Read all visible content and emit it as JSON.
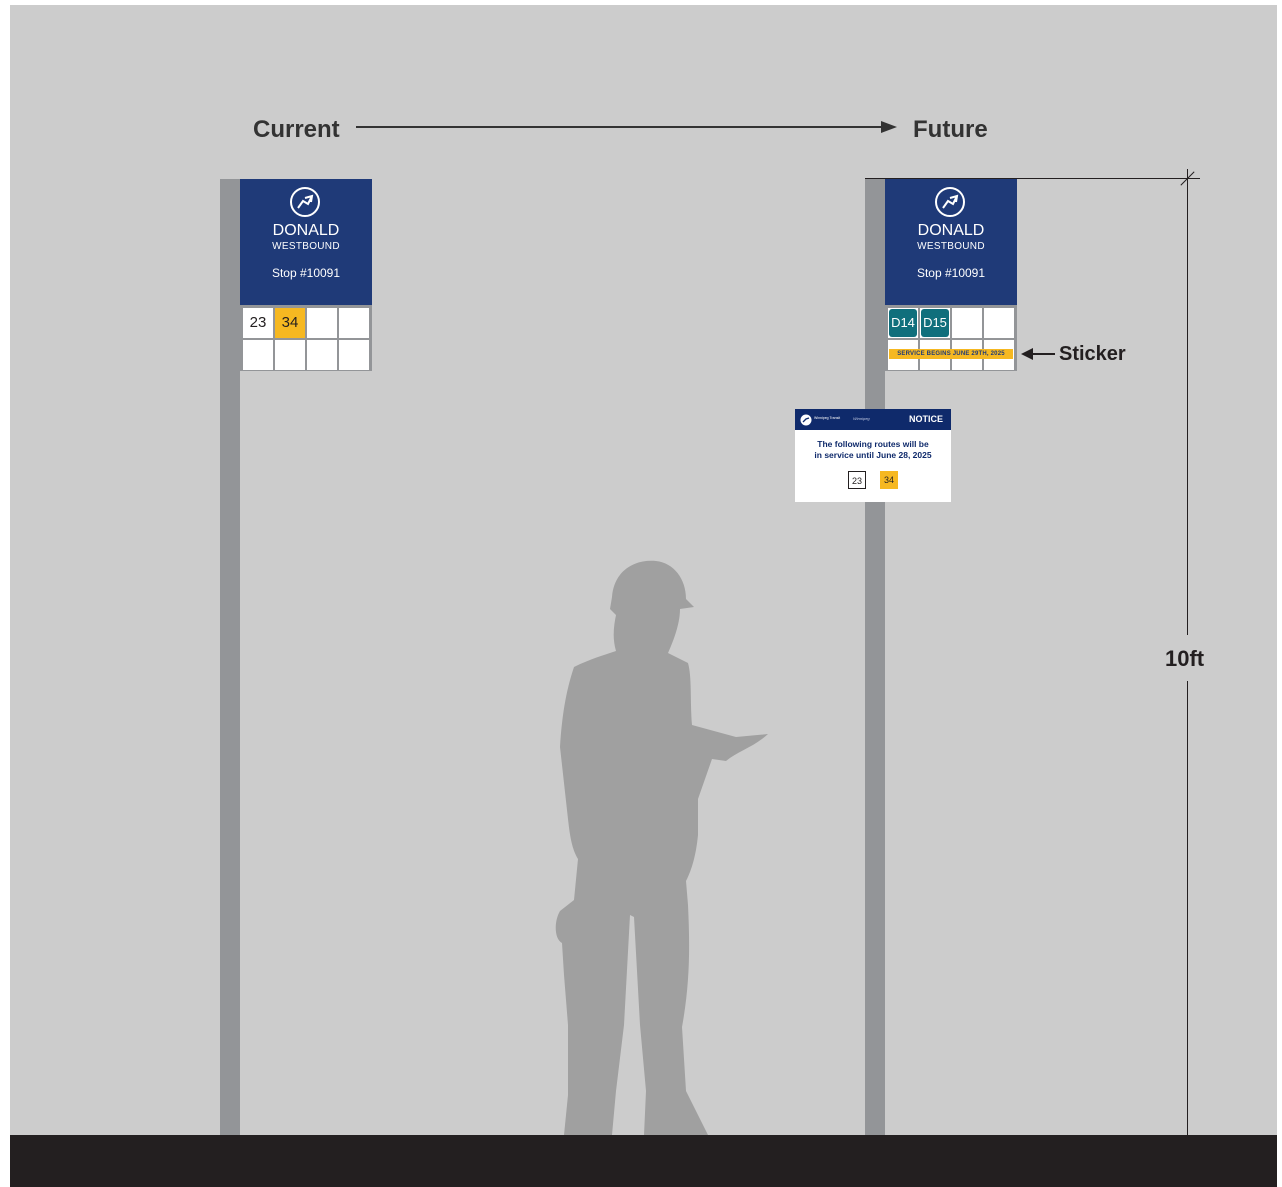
{
  "labels": {
    "current": "Current",
    "future": "Future",
    "sticker": "Sticker",
    "height": "10ft"
  },
  "current_sign": {
    "stop_name": "DONALD",
    "direction": "WESTBOUND",
    "stop_number": "Stop #10091",
    "routes": [
      "23",
      "34"
    ]
  },
  "future_sign": {
    "stop_name": "DONALD",
    "direction": "WESTBOUND",
    "stop_number": "Stop #10091",
    "routes": [
      "D14",
      "D15"
    ],
    "sticker_text": "SERVICE BEGINS JUNE 29TH, 2025"
  },
  "notice": {
    "title": "NOTICE",
    "org_primary": "Winnipeg Transit",
    "org_secondary": "Winnipeg",
    "line1": "The following routes will be",
    "line2": "in service until June 28, 2025",
    "routes": [
      "23",
      "34"
    ]
  },
  "colors": {
    "background": "#cccccc",
    "ground": "#231f20",
    "pole": "#939598",
    "sign_blue": "#1f3a78",
    "route_yellow": "#f6b821",
    "route_teal": "#106f7c",
    "silhouette": "#a0a0a0"
  }
}
